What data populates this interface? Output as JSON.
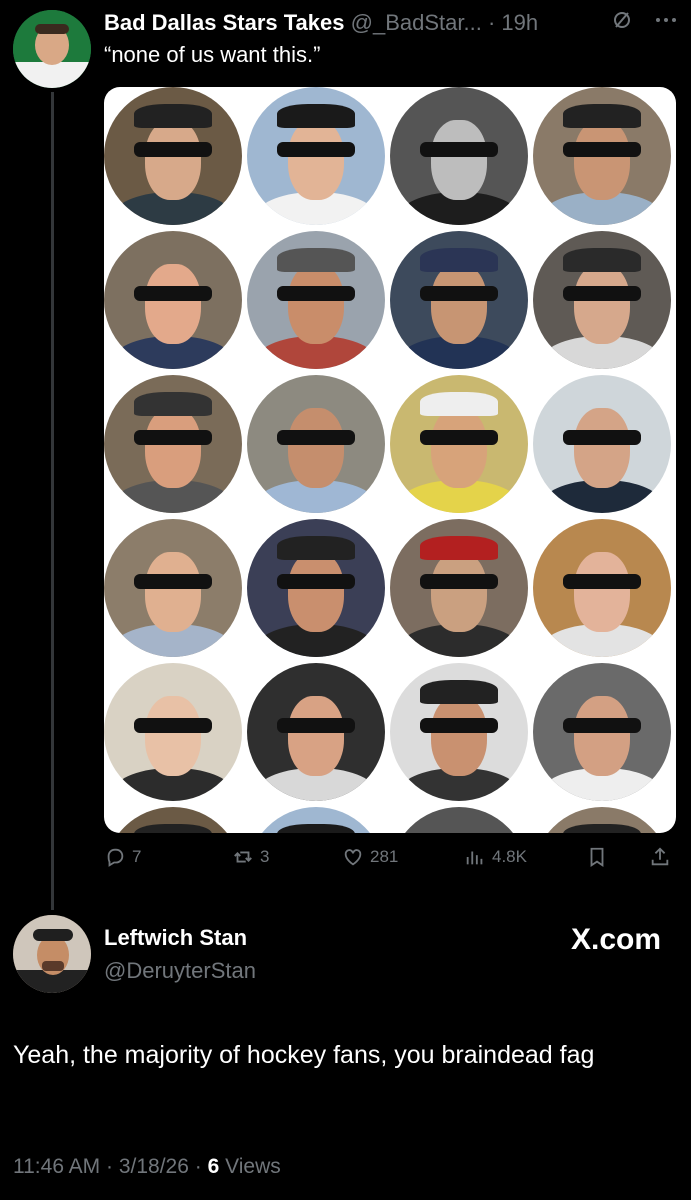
{
  "tweet": {
    "author_name": "Bad Dallas Stars Takes",
    "handle": "@_BadStar...",
    "separator": "·",
    "time": "19h",
    "text": "“none of us want this.”",
    "media_description_icon": "grid-of-profile-photos",
    "actions": {
      "replies": "7",
      "retweets": "3",
      "likes": "281",
      "views": "4.8K"
    }
  },
  "reply": {
    "author_name": "Leftwich Stan",
    "handle": "@DeruyterStan",
    "source": "X.com",
    "text": "Yeah, the majority of hockey fans, you braindead fag",
    "time": "11:46 AM",
    "date": "3/18/26",
    "views_count": "6",
    "views_label": "Views"
  },
  "colors": {
    "background": "#000000",
    "text": "#e7e9ea",
    "muted": "#71767b",
    "divider": "#333639"
  }
}
